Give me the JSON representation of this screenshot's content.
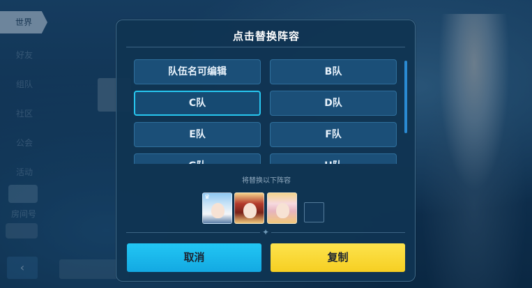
{
  "background": {
    "nav": [
      "世界",
      "好友",
      "组队",
      "社区",
      "公会",
      "活动"
    ],
    "room_label": "房间号",
    "back_glyph": "‹"
  },
  "modal": {
    "title": "点击替换阵容",
    "teams": [
      {
        "label": "队伍名可编辑",
        "selected": false
      },
      {
        "label": "B队",
        "selected": false
      },
      {
        "label": "C队",
        "selected": true
      },
      {
        "label": "D队",
        "selected": false
      },
      {
        "label": "E队",
        "selected": false
      },
      {
        "label": "F队",
        "selected": false
      },
      {
        "label": "G队",
        "selected": false
      },
      {
        "label": "H队",
        "selected": false
      }
    ],
    "replace_label": "将替换以下阵容",
    "lineup": [
      {
        "icon": "white-hair-valkyrie-portrait"
      },
      {
        "icon": "red-hair-valkyrie-portrait"
      },
      {
        "icon": "pink-hair-valkyrie-portrait"
      },
      {
        "icon": "empty-slot"
      }
    ],
    "cancel_label": "取消",
    "copy_label": "复制"
  },
  "colors": {
    "cancel": "#13a9e2",
    "copy": "#f6cf22",
    "selected_border": "#27c7f0"
  }
}
